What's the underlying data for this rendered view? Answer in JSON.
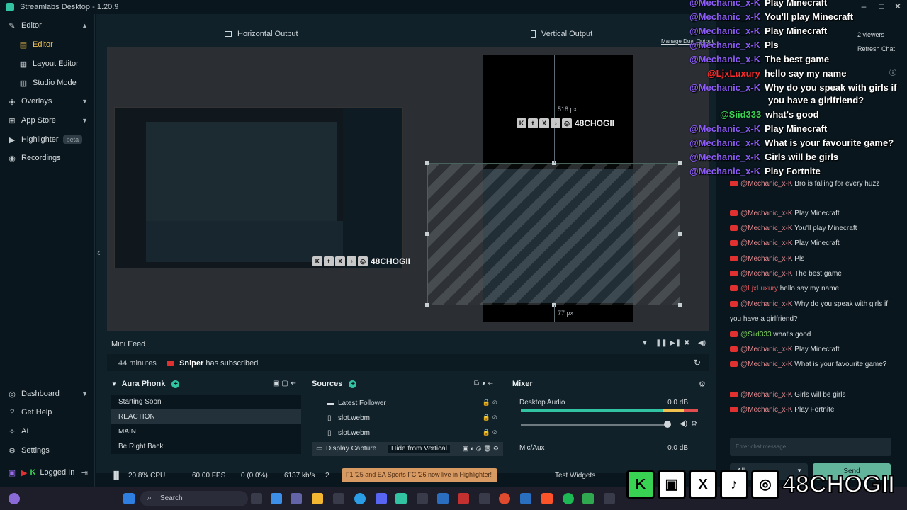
{
  "app": {
    "title": "Streamlabs Desktop - 1.20.9"
  },
  "sidebar": {
    "editor": "Editor",
    "editor_sub": "Editor",
    "layout_editor": "Layout Editor",
    "studio_mode": "Studio Mode",
    "overlays": "Overlays",
    "app_store": "App Store",
    "highlighter": "Highlighter",
    "highlighter_badge": "beta",
    "recordings": "Recordings",
    "dashboard": "Dashboard",
    "get_help": "Get Help",
    "ai": "AI",
    "settings": "Settings",
    "logged_in": "Logged In"
  },
  "outputs": {
    "horizontal": "Horizontal Output",
    "vertical": "Vertical Output",
    "manage": "Manage Dual Output",
    "px_top": "518 px",
    "px_bottom": "77 px"
  },
  "brand_badge": "48CHOGII",
  "minifeed": {
    "title": "Mini Feed",
    "time": "44 minutes",
    "user": "Sniper",
    "action": "has subscribed"
  },
  "scenes": {
    "title": "Aura Phonk",
    "items": [
      "Starting Soon",
      "REACTION",
      "MAIN",
      "Be Right Back"
    ],
    "selected_index": 1
  },
  "sources": {
    "title": "Sources",
    "items": [
      "Latest Follower",
      "slot.webm",
      "slot.webm"
    ],
    "selected": "Display Capture",
    "tooltip": "Hide from Vertical"
  },
  "mixer": {
    "title": "Mixer",
    "channels": [
      {
        "name": "Desktop Audio",
        "level": "0.0 dB"
      },
      {
        "name": "Mic/Aux",
        "level": "0.0 dB"
      }
    ],
    "slider_fraction": 0.95
  },
  "status": {
    "cpu": "20.8% CPU",
    "fps": "60.00 FPS",
    "dropped": "0 (0.0%)",
    "bitrate": "6137 kb/s",
    "notifications": "2",
    "highlight_banner": "F1 '25 and EA Sports FC '26 now live in Highlighter!",
    "test_widgets": "Test Widgets"
  },
  "chat": {
    "viewers": "2 viewers",
    "refresh": "Refresh Chat",
    "input_placeholder": "Enter chat message",
    "channel": "All",
    "send": "Send",
    "messages": [
      {
        "user": "@Mechanic_x-K",
        "text": "Bro is falling for every huzz",
        "color": "pink"
      },
      {
        "user": "@Mechanic_x-K",
        "text": "Play Minecraft",
        "color": "pink"
      },
      {
        "user": "@Mechanic_x-K",
        "text": "You'll play Minecraft",
        "color": "pink"
      },
      {
        "user": "@Mechanic_x-K",
        "text": "Play Minecraft",
        "color": "pink"
      },
      {
        "user": "@Mechanic_x-K",
        "text": "Pls",
        "color": "pink"
      },
      {
        "user": "@Mechanic_x-K",
        "text": "The best game",
        "color": "pink"
      },
      {
        "user": "@LjxLuxury",
        "text": "hello say my name",
        "color": "red"
      },
      {
        "user": "@Mechanic_x-K",
        "text": "Why do you speak with girls if you have a girlfriend?",
        "color": "pink"
      },
      {
        "user": "@Siid333",
        "text": "what's good",
        "color": "green"
      },
      {
        "user": "@Mechanic_x-K",
        "text": "Play Minecraft",
        "color": "pink"
      },
      {
        "user": "@Mechanic_x-K",
        "text": "What is your favourite game?",
        "color": "pink"
      },
      {
        "user": "@Mechanic_x-K",
        "text": "Girls will be girls",
        "color": "pink"
      },
      {
        "user": "@Mechanic_x-K",
        "text": "Play Fortnite",
        "color": "pink"
      }
    ]
  },
  "overlay_chat": [
    {
      "user": "@Mechanic_x-K",
      "text": "Play Minecraft"
    },
    {
      "user": "@Mechanic_x-K",
      "text": "You'll play Minecraft"
    },
    {
      "user": "@Mechanic_x-K",
      "text": "Play Minecraft"
    },
    {
      "user": "@Mechanic_x-K",
      "text": "Pls"
    },
    {
      "user": "@Mechanic_x-K",
      "text": "The best game"
    },
    {
      "user": "@LjxLuxury",
      "text": "hello say my name"
    },
    {
      "user": "@Mechanic_x-K",
      "text": "Why do you speak with girls if"
    },
    {
      "user": "",
      "text": "you have a girlfriend?"
    },
    {
      "user": "@Siid333",
      "text": "what's good"
    },
    {
      "user": "@Mechanic_x-K",
      "text": "Play Minecraft"
    },
    {
      "user": "@Mechanic_x-K",
      "text": "What is your favourite game?"
    },
    {
      "user": "@Mechanic_x-K",
      "text": "Girls will be girls"
    },
    {
      "user": "@Mechanic_x-K",
      "text": "Play Fortnite"
    }
  ],
  "taskbar": {
    "search": "Search"
  },
  "colors": {
    "accent": "#31c3a2",
    "active_nav": "#f2c14e",
    "background": "#09161d",
    "overlay_name": "#8b5cf6"
  }
}
